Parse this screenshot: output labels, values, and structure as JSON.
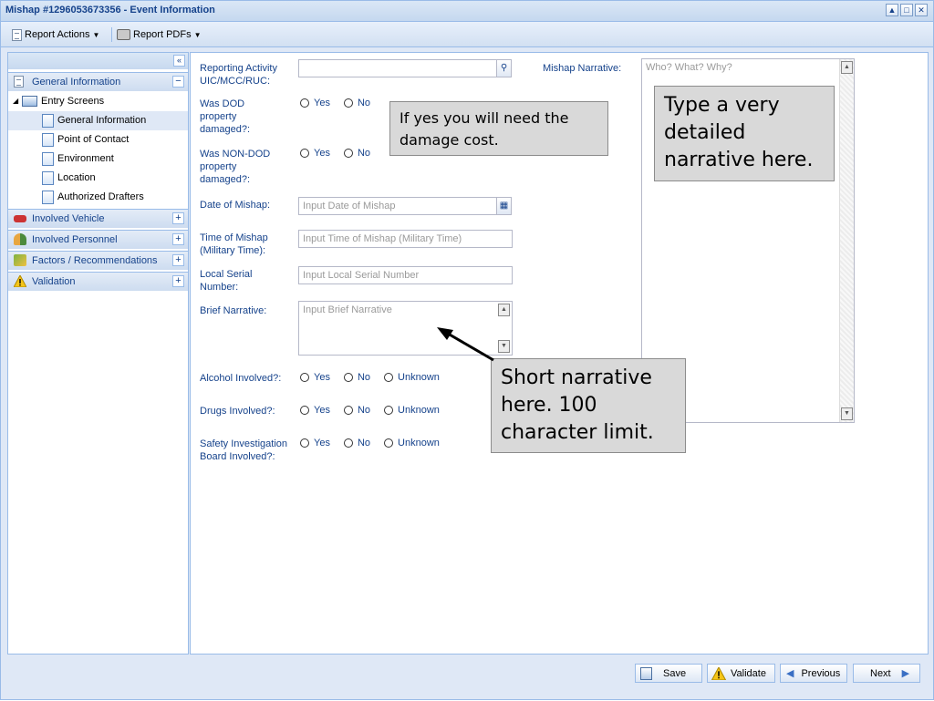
{
  "window": {
    "title": "Mishap #1296053673356 - Event Information"
  },
  "toolbar": {
    "report_actions": "Report Actions",
    "report_pdfs": "Report PDFs"
  },
  "nav": {
    "general_information": "General Information",
    "entry_screens": "Entry Screens",
    "items": [
      "General Information",
      "Point of Contact",
      "Environment",
      "Location",
      "Authorized Drafters"
    ],
    "sections": [
      "Involved Vehicle",
      "Involved Personnel",
      "Factors / Recommendations",
      "Validation"
    ]
  },
  "form": {
    "reporting_activity_label": "Reporting Activity UIC/MCC/RUC:",
    "reporting_activity_value": "",
    "dod_damaged_label": "Was DOD property damaged?:",
    "non_dod_damaged_label": "Was NON-DOD property damaged?:",
    "date_label": "Date of Mishap:",
    "date_placeholder": "Input Date of Mishap",
    "time_label": "Time of Mishap (Military Time):",
    "time_placeholder": "Input Time of Mishap (Military Time)",
    "serial_label": "Local Serial Number:",
    "serial_placeholder": "Input Local Serial Number",
    "brief_label": "Brief Narrative:",
    "brief_placeholder": "Input Brief Narrative",
    "alcohol_label": "Alcohol Involved?:",
    "drugs_label": "Drugs Involved?:",
    "sib_label": "Safety Investigation Board Involved?:",
    "yes": "Yes",
    "no": "No",
    "unknown": "Unknown",
    "mishap_narrative_label": "Mishap Narrative:",
    "mishap_narrative_placeholder": "Who? What? Why?"
  },
  "callouts": {
    "damage": "If yes you will need the damage cost.",
    "detailed": "Type a very detailed narrative here.",
    "short": "Short narrative here.  100 character limit."
  },
  "footer": {
    "save": "Save",
    "validate": "Validate",
    "previous": "Previous",
    "next": "Next"
  }
}
